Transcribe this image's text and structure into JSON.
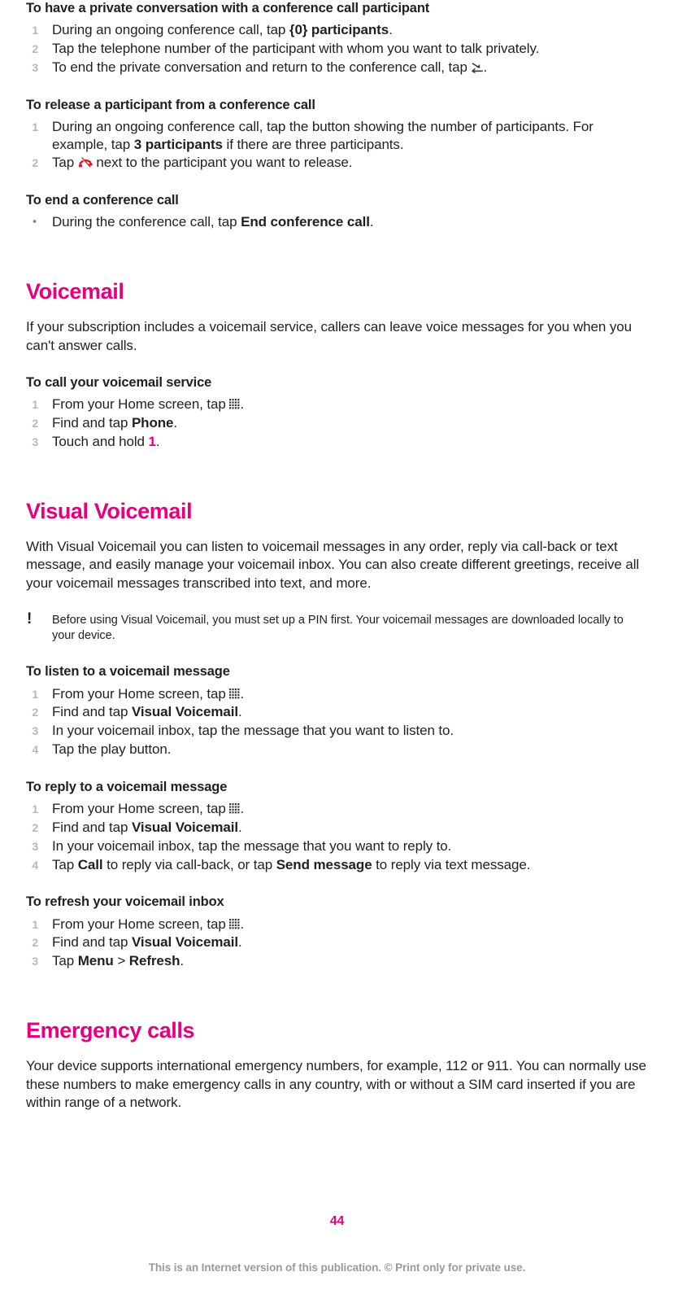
{
  "page": {
    "number": "44",
    "footer_note": "This is an Internet version of this publication. © Print only for private use."
  },
  "icons": {
    "app_drawer": "app-drawer-icon",
    "end_call_arrow": "end-call-arrow-icon",
    "hangup_red": "hangup-handset-icon",
    "note_marker": "!"
  },
  "sections": [
    {
      "id": "private-conversation",
      "type": "procedure",
      "title": "To have a private conversation with a conference call participant",
      "steps": [
        {
          "parts": [
            {
              "t": "During an ongoing conference call, tap "
            },
            {
              "t": "{0} participants",
              "bold": true
            },
            {
              "t": "."
            }
          ]
        },
        {
          "parts": [
            {
              "t": "Tap the telephone number of the participant with whom you want to talk privately."
            }
          ]
        },
        {
          "parts": [
            {
              "t": "To end the private conversation and return to the conference call, tap "
            },
            {
              "icon": "end_call_arrow"
            },
            {
              "t": "."
            }
          ]
        }
      ]
    },
    {
      "id": "release-participant",
      "type": "procedure",
      "title": "To release a participant from a conference call",
      "steps": [
        {
          "parts": [
            {
              "t": "During an ongoing conference call, tap the button showing the number of participants. For example, tap "
            },
            {
              "t": "3 participants",
              "bold": true
            },
            {
              "t": " if there are three participants."
            }
          ]
        },
        {
          "parts": [
            {
              "t": "Tap "
            },
            {
              "icon": "hangup_red"
            },
            {
              "t": " next to the participant you want to release."
            }
          ]
        }
      ]
    },
    {
      "id": "end-conference-call",
      "type": "procedure-bullet",
      "title": "To end a conference call",
      "steps": [
        {
          "parts": [
            {
              "t": "During the conference call, tap "
            },
            {
              "t": "End conference call",
              "bold": true
            },
            {
              "t": "."
            }
          ]
        }
      ]
    },
    {
      "id": "voicemail",
      "type": "heading",
      "title": "Voicemail"
    },
    {
      "id": "voicemail-intro",
      "type": "paragraph",
      "parts": [
        {
          "t": "If your subscription includes a voicemail service, callers can leave voice messages for you when you can't answer calls."
        }
      ]
    },
    {
      "id": "call-voicemail-service",
      "type": "procedure",
      "title": "To call your voicemail service",
      "steps": [
        {
          "parts": [
            {
              "t": "From your Home screen, tap "
            },
            {
              "icon": "app_drawer"
            },
            {
              "t": "."
            }
          ]
        },
        {
          "parts": [
            {
              "t": "Find and tap "
            },
            {
              "t": "Phone",
              "bold": true
            },
            {
              "t": "."
            }
          ]
        },
        {
          "parts": [
            {
              "t": "Touch and hold "
            },
            {
              "t": "1",
              "pink": true
            },
            {
              "t": "."
            }
          ]
        }
      ]
    },
    {
      "id": "visual-voicemail",
      "type": "heading",
      "title": "Visual Voicemail"
    },
    {
      "id": "visual-voicemail-intro",
      "type": "paragraph",
      "parts": [
        {
          "t": "With Visual Voicemail you can listen to voicemail messages in any order, reply via call-back or text message, and easily manage your voicemail inbox. You can also create different greetings, receive all your voicemail messages transcribed into text, and more."
        }
      ]
    },
    {
      "id": "visual-voicemail-note",
      "type": "note",
      "text": "Before using Visual Voicemail, you must set up a PIN first. Your voicemail messages are downloaded locally to your device."
    },
    {
      "id": "listen-voicemail",
      "type": "procedure",
      "title": "To listen to a voicemail message",
      "steps": [
        {
          "parts": [
            {
              "t": "From your Home screen, tap "
            },
            {
              "icon": "app_drawer"
            },
            {
              "t": "."
            }
          ]
        },
        {
          "parts": [
            {
              "t": "Find and tap "
            },
            {
              "t": "Visual Voicemail",
              "bold": true
            },
            {
              "t": "."
            }
          ]
        },
        {
          "parts": [
            {
              "t": "In your voicemail inbox, tap the message that you want to listen to."
            }
          ]
        },
        {
          "parts": [
            {
              "t": "Tap the play button."
            }
          ]
        }
      ]
    },
    {
      "id": "reply-voicemail",
      "type": "procedure",
      "title": "To reply to a voicemail message",
      "steps": [
        {
          "parts": [
            {
              "t": "From your Home screen, tap "
            },
            {
              "icon": "app_drawer"
            },
            {
              "t": "."
            }
          ]
        },
        {
          "parts": [
            {
              "t": "Find and tap "
            },
            {
              "t": "Visual Voicemail",
              "bold": true
            },
            {
              "t": "."
            }
          ]
        },
        {
          "parts": [
            {
              "t": "In your voicemail inbox, tap the message that you want to reply to."
            }
          ]
        },
        {
          "parts": [
            {
              "t": "Tap "
            },
            {
              "t": "Call",
              "bold": true
            },
            {
              "t": " to reply via call-back, or tap "
            },
            {
              "t": "Send message",
              "bold": true
            },
            {
              "t": " to reply via text message."
            }
          ]
        }
      ]
    },
    {
      "id": "refresh-voicemail-inbox",
      "type": "procedure",
      "title": "To refresh your voicemail inbox",
      "steps": [
        {
          "parts": [
            {
              "t": "From your Home screen, tap "
            },
            {
              "icon": "app_drawer"
            },
            {
              "t": "."
            }
          ]
        },
        {
          "parts": [
            {
              "t": "Find and tap "
            },
            {
              "t": "Visual Voicemail",
              "bold": true
            },
            {
              "t": "."
            }
          ]
        },
        {
          "parts": [
            {
              "t": "Tap "
            },
            {
              "t": "Menu",
              "bold": true
            },
            {
              "t": " > "
            },
            {
              "t": "Refresh",
              "bold": true
            },
            {
              "t": "."
            }
          ]
        }
      ]
    },
    {
      "id": "emergency-calls",
      "type": "heading",
      "title": "Emergency calls"
    },
    {
      "id": "emergency-calls-intro",
      "type": "paragraph",
      "parts": [
        {
          "t": "Your device supports international emergency numbers, for example, 112 or 911. You can normally use these numbers to make emergency calls in any country, with or without a SIM card inserted if you are within range of a network."
        }
      ]
    }
  ]
}
